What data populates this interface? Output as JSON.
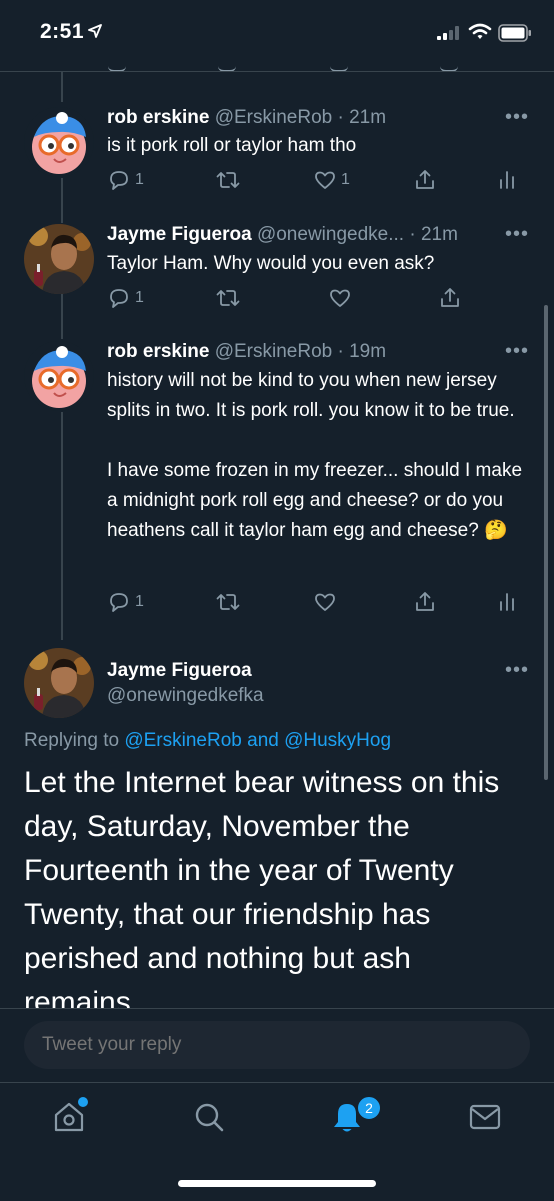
{
  "status": {
    "time": "2:51"
  },
  "tweets": [
    {
      "name": "rob erskine",
      "handle": "@ErskineRob",
      "time": "· 21m",
      "text": "is it pork roll or taylor ham tho",
      "replies": "1",
      "likes": "1"
    },
    {
      "name": "Jayme Figueroa",
      "handle": "@onewingedke...",
      "time": "· 21m",
      "text": "Taylor Ham. Why would you even ask?",
      "replies": "1"
    },
    {
      "name": "rob erskine",
      "handle": "@ErskineRob",
      "time": "· 19m",
      "text": "history will not be kind to you when new jersey splits in two. It is pork roll. you know it to be true.\n\nI have some frozen in my freezer... should I make a midnight pork roll egg and cheese? or do you heathens call it taylor ham egg and cheese? 🤔",
      "replies": "1"
    }
  ],
  "main_tweet": {
    "name": "Jayme Figueroa",
    "handle": "@onewingedkefka",
    "replying_prefix": "Replying to",
    "replying_to_1": "@ErskineRob",
    "replying_and": "and",
    "replying_to_2": "@HuskyHog",
    "text": "Let the Internet bear witness on this day, Saturday, November the Fourteenth in the year of Twenty Twenty, that our friendship has perished and nothing but ash remains."
  },
  "reply_box": {
    "placeholder": "Tweet your reply"
  },
  "tab_bar": {
    "notifications_badge": "2"
  },
  "more_glyph": "•••",
  "colors": {
    "background": "#15202b",
    "accent": "#1da1f2",
    "muted": "#8899a6"
  },
  "icons": [
    "location-arrow-icon",
    "signal-icon",
    "wifi-icon",
    "battery-icon",
    "reply-icon",
    "retweet-icon",
    "like-icon",
    "share-icon",
    "analytics-icon",
    "home-icon",
    "search-icon",
    "notifications-icon",
    "messages-icon"
  ]
}
